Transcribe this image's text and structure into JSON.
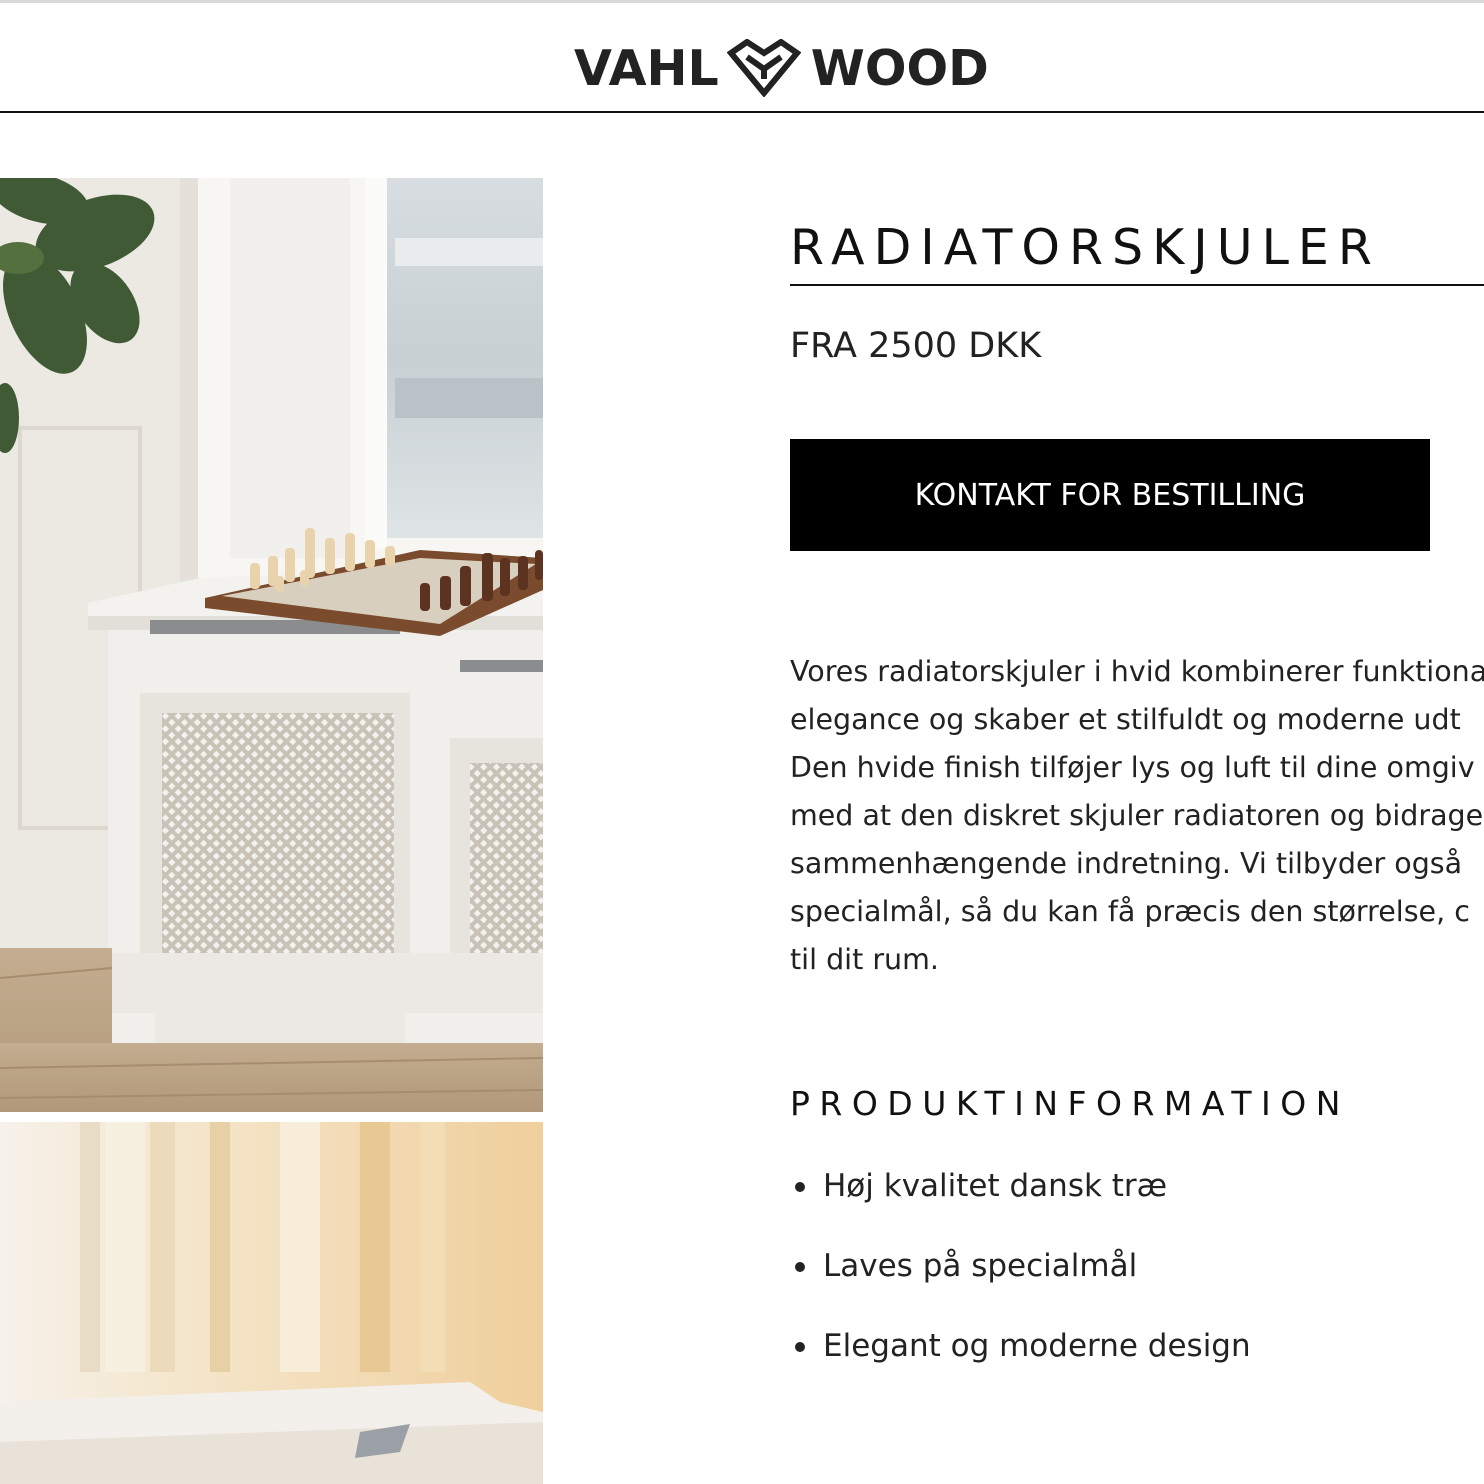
{
  "header": {
    "brand_left": "VAHL",
    "brand_right": "WOOD",
    "brand_icon": "heart-diamond-logo-icon"
  },
  "gallery": {
    "images": [
      {
        "alt": "Hvid radiatorskjuler under vindue med skakbræt"
      },
      {
        "alt": "Hvid radiatorskjuler i varmt lys"
      }
    ]
  },
  "product": {
    "title": "RADIATORSKJULER",
    "price": "FRA 2500 DKK",
    "cta_label": "KONTAKT FOR BESTILLING",
    "description_lines": [
      "Vores radiatorskjuler i hvid kombinerer funktiona",
      "elegance og skaber et stilfuldt og moderne udt",
      "Den hvide finish tilføjer lys og luft til dine omgiv",
      "med at den diskret skjuler radiatoren og bidrage",
      "sammenhængende indretning. Vi tilbyder også",
      "specialmål, så du kan få præcis den størrelse, c",
      "til dit rum."
    ]
  },
  "product_info": {
    "heading": "PRODUKTINFORMATION",
    "items": [
      "Høj kvalitet dansk træ",
      "Laves på specialmål",
      "Elegant og moderne design"
    ]
  },
  "colors": {
    "cta_background": "#000000",
    "cta_text": "#ffffff",
    "text": "#111111"
  }
}
